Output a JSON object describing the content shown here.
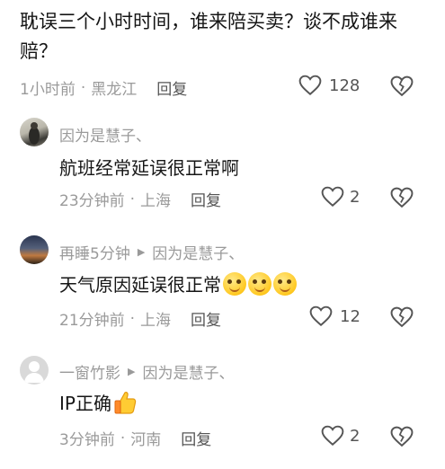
{
  "post": {
    "text": "耽误三个小时时间，谁来陪买卖？谈不成谁来赔？",
    "time": "1小时前",
    "location": "黑龙江",
    "reply_label": "回复",
    "likes": "128"
  },
  "replies": [
    {
      "username": "因为是慧子、",
      "reply_to": "",
      "text": "航班经常延误很正常啊",
      "time": "23分钟前",
      "location": "上海",
      "reply_label": "回复",
      "likes": "2"
    },
    {
      "username": "再睡5分钟",
      "reply_to": "因为是慧子、",
      "text": "天气原因延误很正常",
      "time": "21分钟前",
      "location": "上海",
      "reply_label": "回复",
      "likes": "12"
    },
    {
      "username": "一窗竹影",
      "reply_to": "因为是慧子、",
      "text": "IP正确",
      "time": "3分钟前",
      "location": "河南",
      "reply_label": "回复",
      "likes": "2"
    }
  ],
  "icons": {
    "like": "heart-outline-icon",
    "dislike": "broken-heart-icon",
    "reply_arrow": "play-triangle-icon",
    "emoji": "smiling-face-icon",
    "thumbs_up": "thumbs-up-icon"
  }
}
